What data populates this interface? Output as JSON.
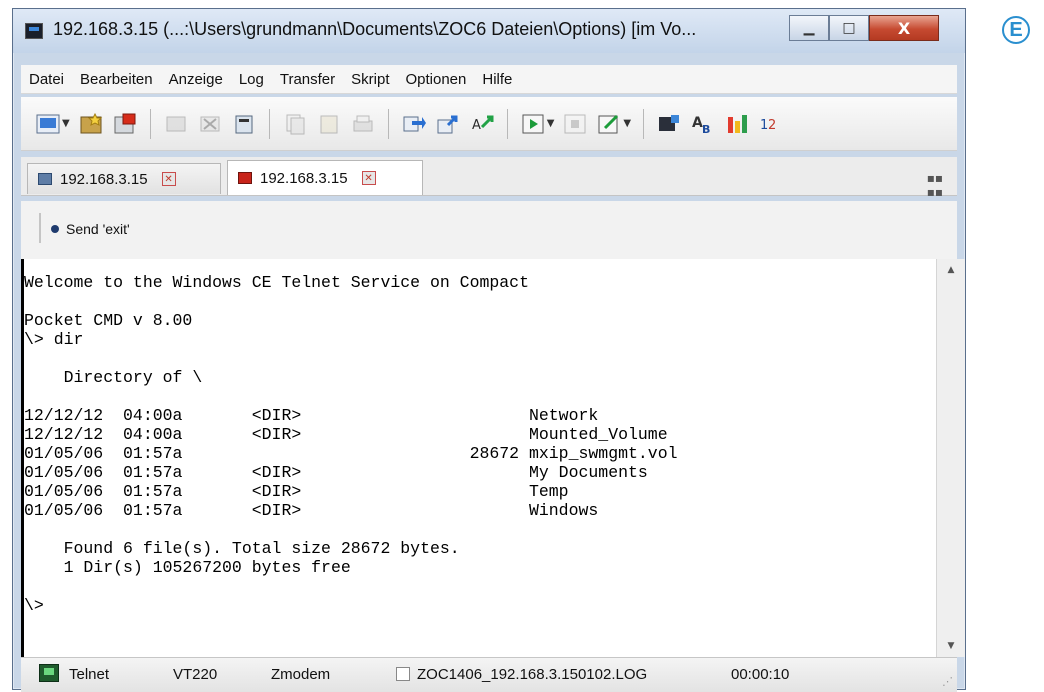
{
  "window": {
    "title": "192.168.3.15 (...:\\Users\\grundmann\\Documents\\ZOC6 Dateien\\Options) [im Vo...",
    "minimize_symbol": "▁",
    "maximize_symbol": "□",
    "close_symbol": "X"
  },
  "menu": [
    "Datei",
    "Bearbeiten",
    "Anzeige",
    "Log",
    "Transfer",
    "Skript",
    "Optionen",
    "Hilfe"
  ],
  "tabs": [
    {
      "label": "192.168.3.15",
      "active": false
    },
    {
      "label": "192.168.3.15",
      "active": true
    }
  ],
  "buttonbar": {
    "send_exit_label": "Send 'exit'"
  },
  "terminal": {
    "lines": [
      "Welcome to the Windows CE Telnet Service on Compact",
      "",
      "Pocket CMD v 8.00",
      "\\> dir",
      "",
      "    Directory of \\",
      "",
      "12/12/12  04:00a       <DIR>                       Network",
      "12/12/12  04:00a       <DIR>                       Mounted_Volume",
      "01/05/06  01:57a                             28672 mxip_swmgmt.vol",
      "01/05/06  01:57a       <DIR>                       My Documents",
      "01/05/06  01:57a       <DIR>                       Temp",
      "01/05/06  01:57a       <DIR>                       Windows",
      "",
      "    Found 6 file(s). Total size 28672 bytes.",
      "    1 Dir(s) 105267200 bytes free",
      "",
      "\\>"
    ]
  },
  "statusbar": {
    "protocol": "Telnet",
    "emulation": "VT220",
    "transfer": "Zmodem",
    "logfile": "ZOC1406_192.168.3.150102.LOG",
    "elapsed": "00:00:10"
  },
  "badge": {
    "letter": "E",
    "color": "#2a8fcf"
  }
}
